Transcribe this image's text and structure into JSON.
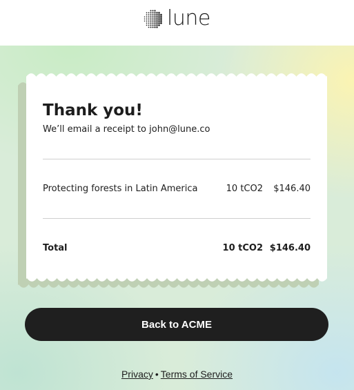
{
  "brand": {
    "name": "lune",
    "icon": "lune-dotted-circle-logo"
  },
  "receipt": {
    "title": "Thank you!",
    "message": "We’ll email a receipt to john@lune.co",
    "items": [
      {
        "label": "Protecting forests in Latin America",
        "quantity": "10 tCO2",
        "price": "$146.40"
      }
    ],
    "total": {
      "label": "Total",
      "quantity": "10 tCO2",
      "price": "$146.40"
    }
  },
  "actions": {
    "back_label": "Back to ACME"
  },
  "footer": {
    "privacy_label": "Privacy",
    "separator": "•",
    "terms_label": "Terms of Service"
  },
  "colors": {
    "button": "#1f1f1f",
    "receipt_bg": "#ffffff",
    "receipt_shadow": "#bfd0b4"
  }
}
